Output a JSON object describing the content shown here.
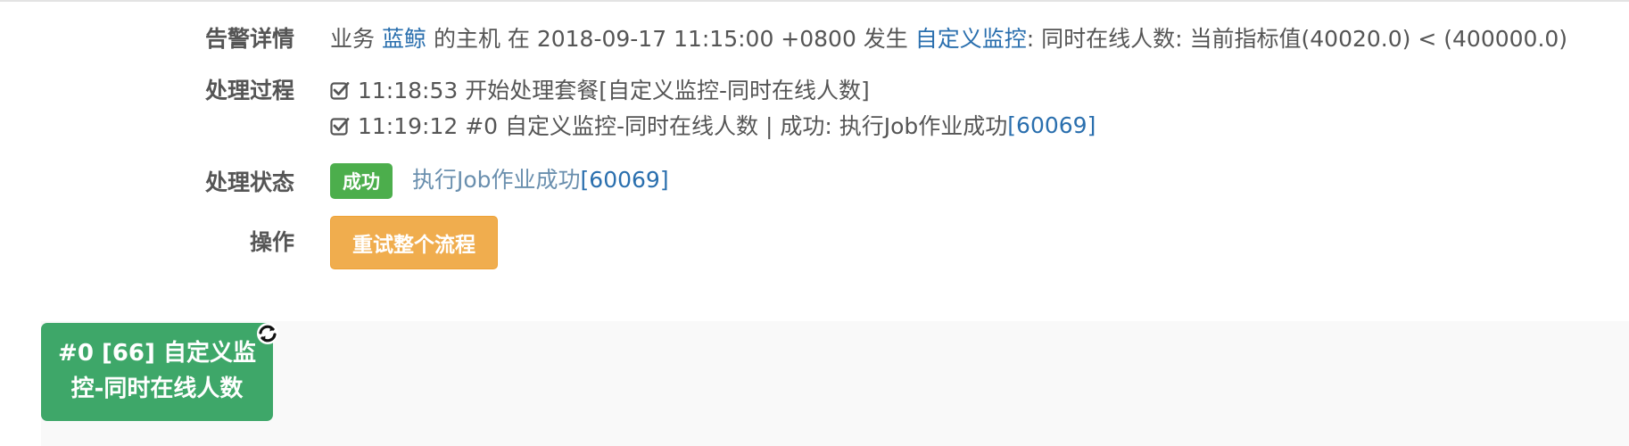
{
  "alert_detail": {
    "label": "告警详情",
    "prefix": "业务",
    "business_link": "蓝鲸",
    "middle": "的主机 在 2018-09-17 11:15:00 +0800 发生",
    "monitor_link": "自定义监控",
    "suffix": ": 同时在线人数: 当前指标值(40020.0) < (400000.0)"
  },
  "process": {
    "label": "处理过程",
    "lines": [
      {
        "text": "11:18:53 开始处理套餐[自定义监控-同时在线人数]",
        "link": ""
      },
      {
        "text": "11:19:12 #0 自定义监控-同时在线人数 | 成功: 执行Job作业成功",
        "link": "[60069]"
      }
    ]
  },
  "status": {
    "label": "处理状态",
    "badge": "成功",
    "message": "执行Job作业成功",
    "message_link": "[60069]",
    "badge_color": "#4cae4c"
  },
  "operation": {
    "label": "操作",
    "retry_button": "重试整个流程",
    "button_color": "#f0ad4e"
  },
  "flow": {
    "node_line1": "#0 [66] 自定义监",
    "node_line2": "控-同时在线人数",
    "node_color": "#3ea769",
    "refresh_icon": "refresh-icon"
  }
}
